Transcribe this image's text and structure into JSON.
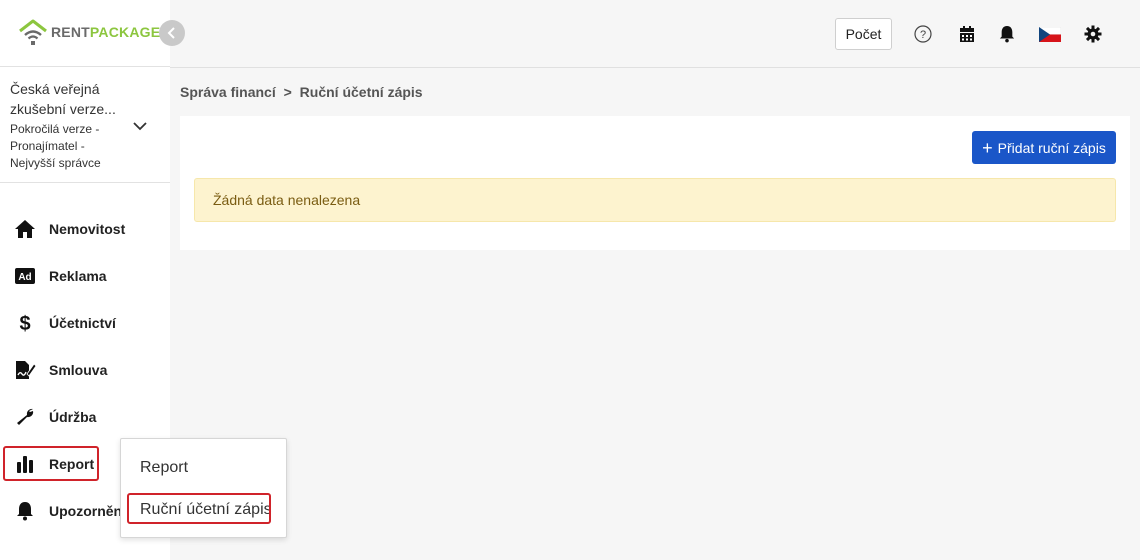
{
  "app": {
    "logo_rent": "RENT",
    "logo_package": "PACKAGE"
  },
  "account": {
    "name": "Česká veřejná zkušební verze...",
    "role": "Pokročilá verze - Pronajímatel - Nejvyšší správce"
  },
  "sidebar": {
    "items": [
      {
        "label": "Nemovitost",
        "icon": "home-icon"
      },
      {
        "label": "Reklama",
        "icon": "ad-icon"
      },
      {
        "label": "Účetnictví",
        "icon": "dollar-icon"
      },
      {
        "label": "Smlouva",
        "icon": "contract-icon"
      },
      {
        "label": "Údržba",
        "icon": "wrench-icon"
      },
      {
        "label": "Report",
        "icon": "bar-chart-icon"
      },
      {
        "label": "Upozornění",
        "icon": "bell-icon"
      }
    ]
  },
  "popup": {
    "items": [
      {
        "label": "Report"
      },
      {
        "label": "Ruční účetní zápis"
      }
    ]
  },
  "header": {
    "count_label": "Počet",
    "icons": [
      "help-icon",
      "calendar-icon",
      "bell-icon",
      "czech-flag-icon",
      "gear-icon"
    ]
  },
  "breadcrumb": {
    "parent": "Správa financí",
    "separator": ">",
    "current": "Ruční účetní zápis"
  },
  "main": {
    "add_button_label": "Přidat ruční zápis",
    "empty_message": "Žádná data nenalezena"
  },
  "colors": {
    "primary": "#1a56c8",
    "brand_green": "#8cc63f",
    "highlight_red": "#d0232a",
    "alert_bg": "#fdf3cf"
  }
}
